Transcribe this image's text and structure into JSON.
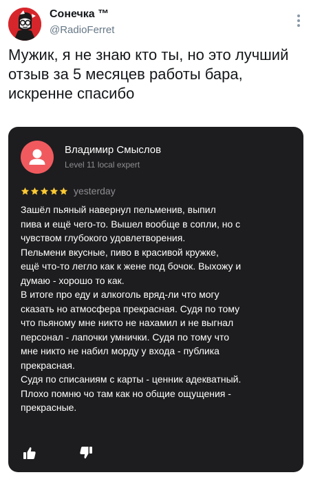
{
  "tweet": {
    "author": {
      "display_name": "Сонечка ™",
      "handle": "@RadioFerret"
    },
    "more_icon": "more-vertical-icon",
    "text_lines": [
      "Мужик, я не знаю кто ты, но это лучший",
      "отзыв за 5 месяцев работы бара,",
      "искренне спасибо"
    ]
  },
  "review": {
    "reviewer_name": "Владимир Смыслов",
    "reviewer_level": "Level 11 local expert",
    "rating": 5,
    "rating_icon": "star-icon",
    "date": "yesterday",
    "text_lines": [
      "Зашёл пьяный навернул пельменив, выпил",
      "пива и ещё чего-то. Вышел вообще в сопли, но с",
      "чувством глубокого удовлетворения.",
      "Пельмени вкусные, пиво в красивой кружке,",
      "ещё что-то легло как к жене под бочок. Выхожу и",
      "думаю - хорошо то как.",
      "В итоге про еду и алкоголь вряд-ли что могу",
      "сказать но атмосфера прекрасная. Судя по тому",
      "что пьяному мне никто не нахамил и не выгнал",
      "персонал - лапочки умнички. Судя по тому что",
      "мне никто не набил морду у входа - публика",
      "прекрасная.",
      "Судя по списаниям с карты - ценник адекватный.",
      "Плохо помню чо там как но общие ощущения -",
      "прекрасные."
    ],
    "actions": {
      "like_icon": "thumbs-up-icon",
      "dislike_icon": "thumbs-down-icon"
    },
    "colors": {
      "card_bg": "#1d1d1f",
      "avatar": "#f05a5e",
      "star": "#fcc934",
      "muted": "#8e8e93"
    }
  }
}
